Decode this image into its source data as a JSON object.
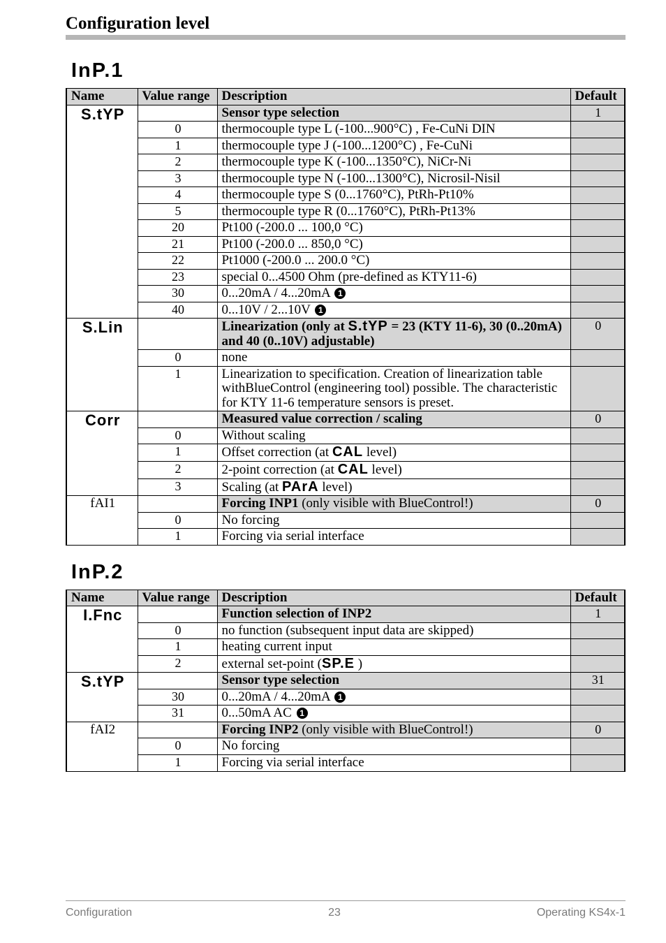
{
  "header": {
    "title": "Configuration level"
  },
  "sections": {
    "inp1": {
      "heading": "InP.1",
      "t": {
        "h_name": "Name",
        "h_range": "Value range",
        "h_desc": "Description",
        "h_def": "Default",
        "r_styp_name": "S.tYP",
        "r_styp_desc": "Sensor type selection",
        "r_styp_def": "1",
        "r0_range": "0",
        "r0_desc": "thermocouple type L (-100...900°C) , Fe-CuNi DIN",
        "r1_range": "1",
        "r1_desc": "thermocouple type J (-100...1200°C) , Fe-CuNi",
        "r2_range": "2",
        "r2_desc": "thermocouple type K (-100...1350°C), NiCr-Ni",
        "r3_range": "3",
        "r3_desc": "thermocouple type N (-100...1300°C), Nicrosil-Nisil",
        "r4_range": "4",
        "r4_desc": "thermocouple type S (0...1760°C), PtRh-Pt10%",
        "r5_range": "5",
        "r5_desc": "thermocouple type R (0...1760°C), PtRh-Pt13%",
        "r20_range": "20",
        "r20_desc": "Pt100 (-200.0 ... 100,0 °C)",
        "r21_range": "21",
        "r21_desc": "Pt100 (-200.0 ... 850,0 °C)",
        "r22_range": "22",
        "r22_desc": "Pt1000 (-200.0 ... 200.0 °C)",
        "r23_range": "23",
        "r23_desc": "special 0...4500 Ohm  (pre-defined as KTY11-6)",
        "r30_range": "30",
        "r30_desc": "0...20mA / 4...20mA ",
        "r40_range": "40",
        "r40_desc": "0...10V / 2...10V ",
        "r_slin_name": "S.Lin",
        "r_slin_desc_a": "Linearization (only at ",
        "r_slin_desc_seg": "S.tYP",
        "r_slin_desc_b": " = 23 (KTY 11-6), 30 (0..20mA) and 40 (0..10V) adjustable)",
        "r_slin_def": "0",
        "r_slin0_range": "0",
        "r_slin0_desc": "none",
        "r_slin1_range": "1",
        "r_slin1_desc": "Linearization to specification. Creation of linearization table withBlueControl (engineering tool) possible. The characteristic for KTY 11-6 temperature sensors is preset.",
        "r_corr_name": "Corr",
        "r_corr_desc": "Measured value correction / scaling",
        "r_corr_def": "0",
        "r_corr0_range": "0",
        "r_corr0_desc": "Without scaling",
        "r_corr1_range": "1",
        "r_corr1_desc_a": "Offset correction  (at ",
        "r_corr1_seg": "CAL",
        "r_corr1_desc_b": " level)",
        "r_corr2_range": "2",
        "r_corr2_desc_a": "2-point correction (at ",
        "r_corr2_seg": "CAL",
        "r_corr2_desc_b": " level)",
        "r_corr3_range": "3",
        "r_corr3_desc_a": "Scaling  (at ",
        "r_corr3_seg": "PArA",
        "r_corr3_desc_b": " level)",
        "r_fai1_name": "fAI1",
        "r_fai1_desc_a": "Forcing INP1",
        "r_fai1_desc_b": " (only visible with BlueControl!)",
        "r_fai1_def": "0",
        "r_fai10_range": "0",
        "r_fai10_desc": "No forcing",
        "r_fai11_range": "1",
        "r_fai11_desc": "Forcing via serial interface"
      }
    },
    "inp2": {
      "heading": "InP.2",
      "t": {
        "h_name": "Name",
        "h_range": "Value range",
        "h_desc": "Description",
        "h_def": "Default",
        "r_ifnc_name": "I.Fnc",
        "r_ifnc_desc": "Function selection of INP2",
        "r_ifnc_def": "1",
        "r0_range": "0",
        "r0_desc": "no function (subsequent input data are skipped)",
        "r1_range": "1",
        "r1_desc": "heating current input",
        "r2_range": "2",
        "r2_desc_a": "external set-point (",
        "r2_seg": "SP.E",
        "r2_desc_b": " )",
        "r_styp_name": "S.tYP",
        "r_styp_desc": "Sensor type selection",
        "r_styp_def": "31",
        "r30_range": "30",
        "r30_desc": "0...20mA / 4...20mA ",
        "r31_range": "31",
        "r31_desc": "0...50mA AC ",
        "r_fai2_name": "fAI2",
        "r_fai2_desc_a": "Forcing INP2",
        "r_fai2_desc_b": " (only visible with BlueControl!)",
        "r_fai2_def": "0",
        "r_fai20_range": "0",
        "r_fai20_desc": "No forcing",
        "r_fai21_range": "1",
        "r_fai21_desc": "Forcing via serial interface"
      }
    }
  },
  "footer": {
    "left": "Configuration",
    "center": "23",
    "right": "Operating KS4x-1"
  },
  "glyph": {
    "circle1": "1"
  }
}
